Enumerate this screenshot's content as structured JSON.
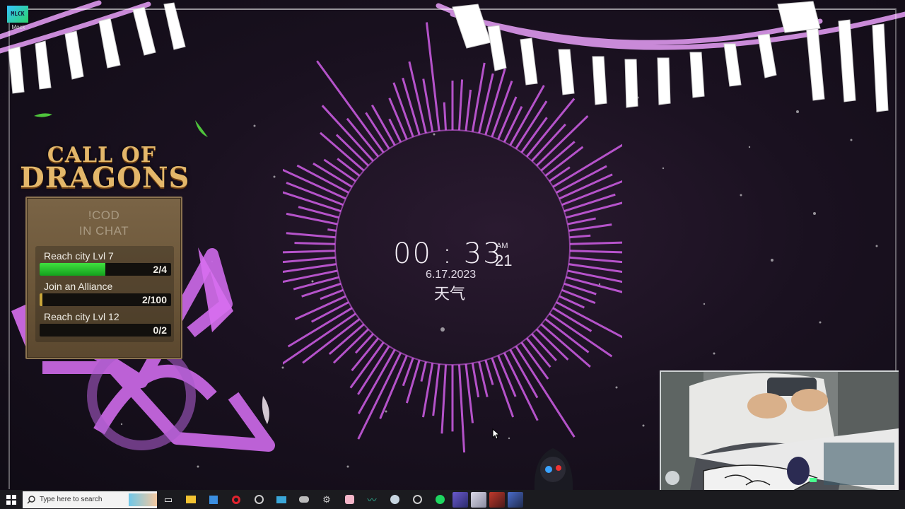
{
  "desktop": {
    "icon_tile_text": "MLCK",
    "icon_caption": "Mock"
  },
  "cod": {
    "logo_line1": "CALL OF",
    "logo_line2": "DRAGONS",
    "cta_line1": "!COD",
    "cta_line2": "IN CHAT",
    "quests": [
      {
        "title": "Reach city Lvl 7",
        "count": "2/4",
        "progress": 0.5
      },
      {
        "title": "Join an Alliance",
        "count": "2/100",
        "progress": 0.02
      },
      {
        "title": "Reach city Lvl 12",
        "count": "0/2",
        "progress": 0.0
      }
    ]
  },
  "clock": {
    "time": "00 : 33",
    "ampm": "AM",
    "seconds": "21",
    "date": "6.17.2023",
    "weather": "天气"
  },
  "taskbar": {
    "search_placeholder": "Type here to search",
    "icons": [
      "task-view-icon",
      "file-explorer-icon",
      "store-icon",
      "opera-icon",
      "speedometer-icon",
      "remote-desktop-icon",
      "controller-icon",
      "settings-icon",
      "obs-icon",
      "streamlabs-icon",
      "steam-icon",
      "spotify-icon"
    ]
  },
  "colors": {
    "accent": "#d05ee8",
    "taskbar": "#1b1b1f",
    "panel": "#6a5538",
    "progress_green": "#2fcf36"
  }
}
